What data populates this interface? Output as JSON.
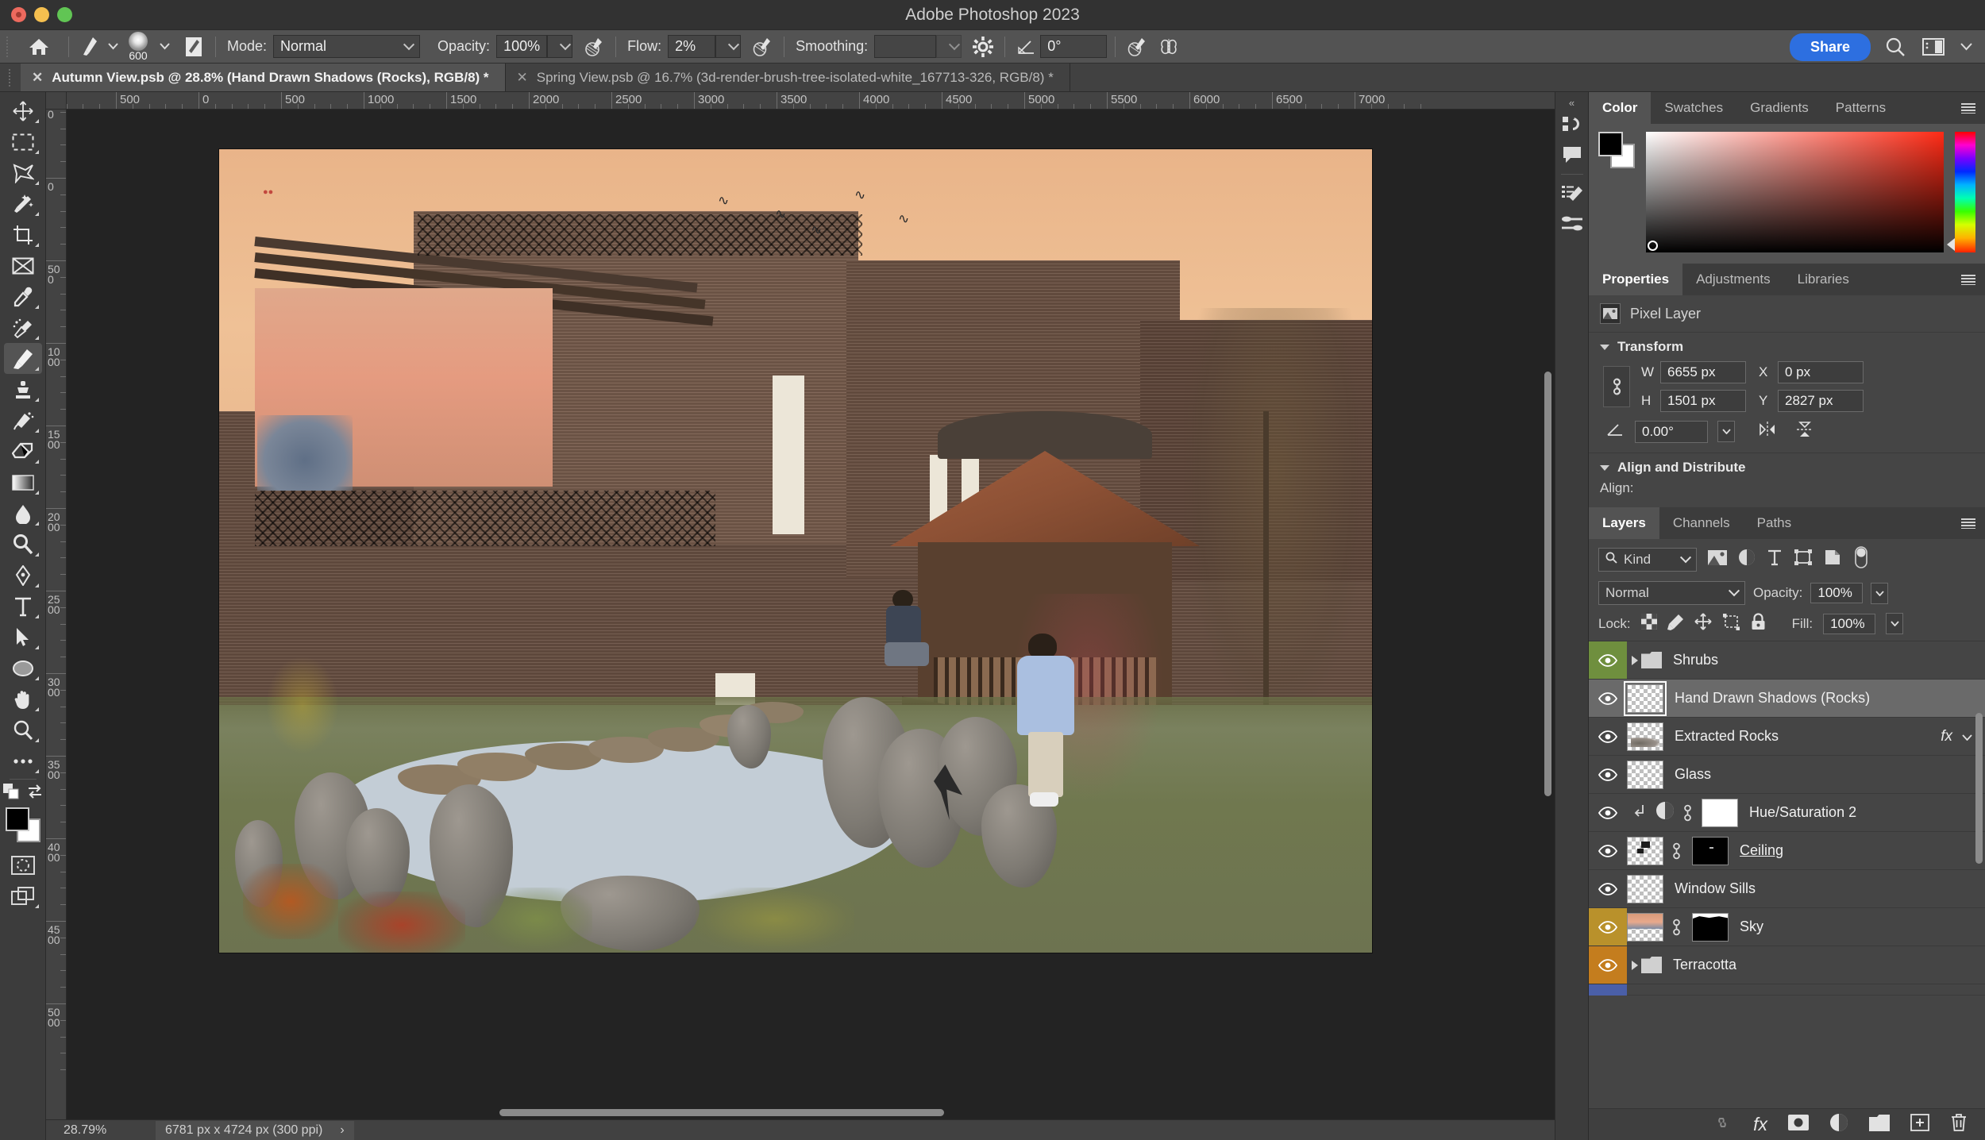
{
  "window": {
    "title": "Adobe Photoshop 2023"
  },
  "options_bar": {
    "home_icon": "home-icon",
    "brush_preset_icon": "brush-preset-icon",
    "brush_size": "600",
    "brush_panel_icon": "brush-panel-icon",
    "mode_label": "Mode:",
    "mode_value": "Normal",
    "opacity_label": "Opacity:",
    "opacity_value": "100%",
    "opacity_pressure_icon": "pressure-opacity-icon",
    "flow_label": "Flow:",
    "flow_value": "2%",
    "airbrush_icon": "airbrush-icon",
    "smoothing_label": "Smoothing:",
    "smoothing_value": "",
    "smoothing_options_icon": "gear-icon",
    "angle_icon": "angle-icon",
    "angle_value": "0°",
    "tablet_pressure_size_icon": "pressure-size-icon",
    "symmetry_icon": "symmetry-butterfly-icon",
    "share_label": "Share",
    "search_icon": "search-icon",
    "workspace_icon": "workspace-icon",
    "chevron_down_icon": "chevron-down-icon"
  },
  "tabs": [
    {
      "title": "Autumn View.psb @ 28.8% (Hand Drawn Shadows (Rocks), RGB/8) *",
      "active": true,
      "close_icon": "close-icon"
    },
    {
      "title": "Spring View.psb @ 16.7% (3d-render-brush-tree-isolated-white_167713-326, RGB/8) *",
      "active": false,
      "close_icon": "close-icon"
    }
  ],
  "toolbar": {
    "tools": [
      {
        "name": "move-tool",
        "icon": "move-icon"
      },
      {
        "name": "rectangular-marquee-tool",
        "icon": "marquee-icon"
      },
      {
        "name": "lasso-tool",
        "icon": "lasso-icon"
      },
      {
        "name": "object-selection-tool",
        "icon": "magic-wand-icon"
      },
      {
        "name": "crop-tool",
        "icon": "crop-icon"
      },
      {
        "name": "frame-tool",
        "icon": "frame-icon"
      },
      {
        "name": "eyedropper-tool",
        "icon": "eyedropper-icon"
      },
      {
        "name": "spot-healing-brush-tool",
        "icon": "healing-brush-icon"
      },
      {
        "name": "brush-tool",
        "icon": "brush-icon",
        "active": true
      },
      {
        "name": "clone-stamp-tool",
        "icon": "clone-stamp-icon"
      },
      {
        "name": "history-brush-tool",
        "icon": "history-brush-icon"
      },
      {
        "name": "eraser-tool",
        "icon": "eraser-icon"
      },
      {
        "name": "gradient-tool",
        "icon": "gradient-icon"
      },
      {
        "name": "blur-tool",
        "icon": "blur-icon"
      },
      {
        "name": "dodge-tool",
        "icon": "dodge-icon"
      },
      {
        "name": "pen-tool",
        "icon": "pen-icon"
      },
      {
        "name": "type-tool",
        "icon": "type-icon"
      },
      {
        "name": "path-selection-tool",
        "icon": "path-select-icon"
      },
      {
        "name": "ellipse-tool",
        "icon": "ellipse-icon"
      },
      {
        "name": "hand-tool",
        "icon": "hand-icon"
      },
      {
        "name": "zoom-tool",
        "icon": "zoom-icon"
      },
      {
        "name": "edit-toolbar",
        "icon": "ellipsis-icon"
      }
    ],
    "foreground_color": "#000000",
    "background_color": "#ffffff",
    "default_colors_icon": "default-colors-icon",
    "swap_colors_icon": "swap-colors-icon",
    "quick_mask_icon": "quick-mask-icon",
    "screen_mode_icon": "screen-mode-icon"
  },
  "rulers": {
    "horizontal": [
      "000",
      "500",
      "0",
      "500",
      "1000",
      "1500",
      "2000",
      "2500",
      "3000",
      "3500",
      "4000",
      "4500",
      "5000",
      "5500",
      "6000",
      "6500",
      "7000"
    ],
    "vertical": [
      "500",
      "0",
      "500",
      "1000",
      "1500",
      "2000",
      "2500",
      "3000",
      "3500",
      "4000",
      "4500",
      "5000"
    ]
  },
  "status_bar": {
    "zoom": "28.79%",
    "doc_size": "6781 px x 4724 px (300 ppi)",
    "expand_icon": "chevron-right-icon"
  },
  "right_rail": {
    "collapse_icon": "collapse-panels-icon",
    "buttons": [
      {
        "name": "history-panel-icon"
      },
      {
        "name": "comments-panel-icon"
      },
      {
        "name": "brush-settings-panel-icon"
      },
      {
        "name": "brush-presets-panel-icon"
      }
    ]
  },
  "color_panel": {
    "tabs": [
      {
        "label": "Color",
        "active": true
      },
      {
        "label": "Swatches",
        "active": false
      },
      {
        "label": "Gradients",
        "active": false
      },
      {
        "label": "Patterns",
        "active": false
      }
    ],
    "menu_icon": "panel-menu-icon",
    "foreground": "#000000",
    "background": "#ffffff",
    "picker_icon": "color-field-picker-icon",
    "hue_slider_icon": "hue-slider-icon"
  },
  "properties_panel": {
    "tabs": [
      {
        "label": "Properties",
        "active": true
      },
      {
        "label": "Adjustments",
        "active": false
      },
      {
        "label": "Libraries",
        "active": false
      }
    ],
    "menu_icon": "panel-menu-icon",
    "layer_type_icon": "pixel-layer-icon",
    "layer_type": "Pixel Layer",
    "transform": {
      "title": "Transform",
      "collapse_icon": "chevron-down-icon",
      "link_icon": "link-wh-icon",
      "w_label": "W",
      "w_value": "6655 px",
      "h_label": "H",
      "h_value": "1501 px",
      "x_label": "X",
      "x_value": "0 px",
      "y_label": "Y",
      "y_value": "2827 px",
      "angle_icon": "angle-icon",
      "angle_value": "0.00°",
      "angle_dropdown_icon": "chevron-down-icon",
      "flip_horizontal_icon": "flip-horizontal-icon",
      "flip_vertical_icon": "flip-vertical-icon"
    },
    "align_distribute": {
      "title": "Align and Distribute",
      "collapse_icon": "chevron-down-icon",
      "align_label": "Align:"
    }
  },
  "layers_panel": {
    "tabs": [
      {
        "label": "Layers",
        "active": true
      },
      {
        "label": "Channels",
        "active": false
      },
      {
        "label": "Paths",
        "active": false
      }
    ],
    "menu_icon": "panel-menu-icon",
    "filter": {
      "search_icon": "search-icon",
      "kind_label": "Kind",
      "chevron_icon": "chevron-down-icon",
      "filter_icons": [
        "pixel-filter-icon",
        "adjustment-filter-icon",
        "type-filter-icon",
        "shape-filter-icon",
        "smart-object-filter-icon"
      ],
      "toggle_icon": "filter-toggle-icon"
    },
    "blend_mode": "Normal",
    "blend_chevron_icon": "chevron-down-icon",
    "opacity_label": "Opacity:",
    "opacity_value": "100%",
    "opacity_stepper_icon": "chevron-down-icon",
    "lock_label": "Lock:",
    "lock_icons": [
      "lock-transparency-icon",
      "lock-image-icon",
      "lock-position-icon",
      "lock-artboard-icon",
      "lock-all-icon"
    ],
    "fill_label": "Fill:",
    "fill_value": "100%",
    "fill_stepper_icon": "chevron-down-icon",
    "layers": [
      {
        "name": "Shrubs",
        "type": "group",
        "visible": true,
        "eye_color": "#6f8f3e",
        "expand_icon": "chevron-right-icon",
        "selected": false
      },
      {
        "name": "Hand Drawn Shadows (Rocks)",
        "type": "pixel",
        "visible": true,
        "eye_color": "",
        "selected": true,
        "thumb": "empty"
      },
      {
        "name": "Extracted Rocks",
        "type": "pixel",
        "visible": true,
        "eye_color": "",
        "selected": false,
        "thumb": "rocks",
        "fx_label": "fx",
        "fx_chevron_icon": "chevron-down-icon"
      },
      {
        "name": "Glass",
        "type": "pixel",
        "visible": true,
        "eye_color": "",
        "selected": false,
        "thumb": "empty"
      },
      {
        "name": "Hue/Saturation 2",
        "type": "adjustment",
        "visible": true,
        "eye_color": "",
        "selected": false,
        "clip_icon": "clipping-mask-icon",
        "adj_icon": "adjustment-icon",
        "link_icon": "mask-link-icon",
        "mask": "white"
      },
      {
        "name": "Ceiling",
        "type": "pixel",
        "visible": true,
        "eye_color": "",
        "selected": false,
        "thumb": "ceiling",
        "link_icon": "mask-link-icon",
        "mask": "black",
        "underlined": true
      },
      {
        "name": "Window Sills",
        "type": "pixel",
        "visible": true,
        "eye_color": "",
        "selected": false,
        "thumb": "empty"
      },
      {
        "name": "Sky",
        "type": "pixel",
        "visible": true,
        "eye_color": "#b9912b",
        "selected": false,
        "thumb": "sky",
        "link_icon": "mask-link-icon",
        "mask": "sky-mask"
      },
      {
        "name": "Terracotta",
        "type": "group",
        "visible": true,
        "eye_color": "#c47d1e",
        "expand_icon": "chevron-right-icon",
        "selected": false
      }
    ],
    "footer_icons": [
      "link-layers-icon",
      "add-layer-style-icon",
      "add-layer-mask-icon",
      "new-adjustment-layer-icon",
      "new-group-icon",
      "new-layer-icon",
      "delete-layer-icon"
    ],
    "footer_fx_label": "fx"
  },
  "canvas": {
    "artwork_name": "autumn-view-composite",
    "description": "Brick building with pergola, gazebo, pond with stepping stones, autumn shrubs, child in blue jacket, person seated on gazebo steps, birds in sky"
  }
}
